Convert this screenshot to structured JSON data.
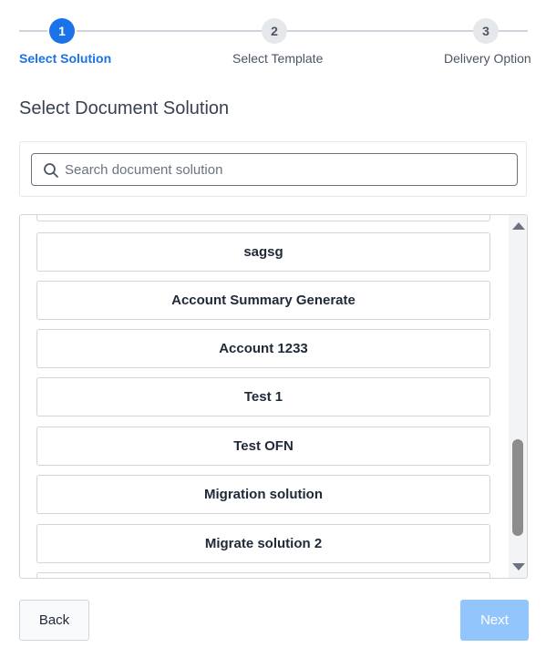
{
  "stepper": {
    "steps": [
      {
        "number": "1",
        "label": "Select Solution",
        "state": "active"
      },
      {
        "number": "2",
        "label": "Select Template",
        "state": "inactive"
      },
      {
        "number": "3",
        "label": "Delivery Option",
        "state": "inactive"
      }
    ]
  },
  "page": {
    "title": "Select Document Solution"
  },
  "search": {
    "placeholder": "Search document solution",
    "value": ""
  },
  "solutions": {
    "items": [
      "",
      "sagsg",
      "Account Summary Generate",
      "Account 1233",
      "Test 1",
      "Test OFN",
      "Migration solution",
      "Migrate solution 2",
      ""
    ],
    "scroll_position_fraction": 0.82
  },
  "footer": {
    "back_label": "Back",
    "next_label": "Next",
    "next_enabled": false
  },
  "colors": {
    "accent": "#1a73e8",
    "next_disabled": "#93c5fd"
  }
}
